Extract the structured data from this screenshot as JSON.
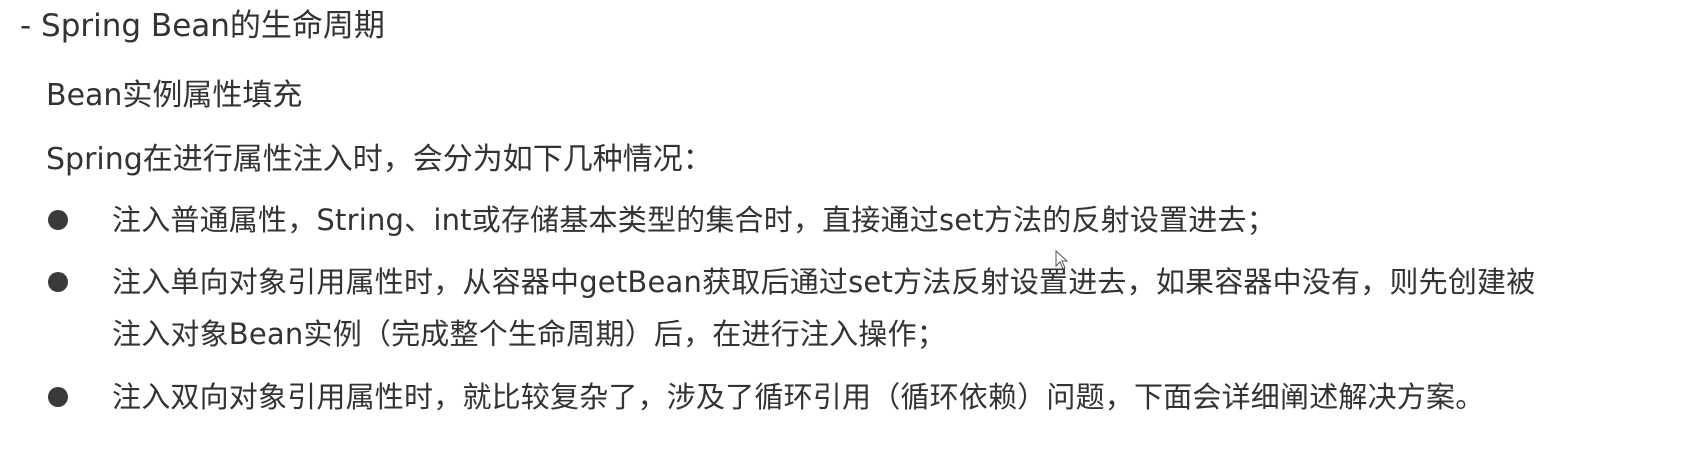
{
  "section": {
    "heading": "- Spring Bean的生命周期",
    "subheading": "Bean实例属性填充",
    "intro": "Spring在进行属性注入时，会分为如下几种情况："
  },
  "items": [
    {
      "text": "注入普通属性，String、int或存储基本类型的集合时，直接通过set方法的反射设置进去；"
    },
    {
      "text": "注入单向对象引用属性时，从容器中getBean获取后通过set方法反射设置进去，如果容器中没有，则先创建被注入对象Bean实例（完成整个生命周期）后，在进行注入操作；"
    },
    {
      "text": "注入双向对象引用属性时，就比较复杂了，涉及了循环引用（循环依赖）问题，下面会详细阐述解决方案。"
    }
  ],
  "icons": {
    "bullet": "bullet-dot-icon",
    "cursor": "mouse-pointer-icon"
  },
  "colors": {
    "text": "#333333",
    "bullet": "#3a3a3a"
  }
}
